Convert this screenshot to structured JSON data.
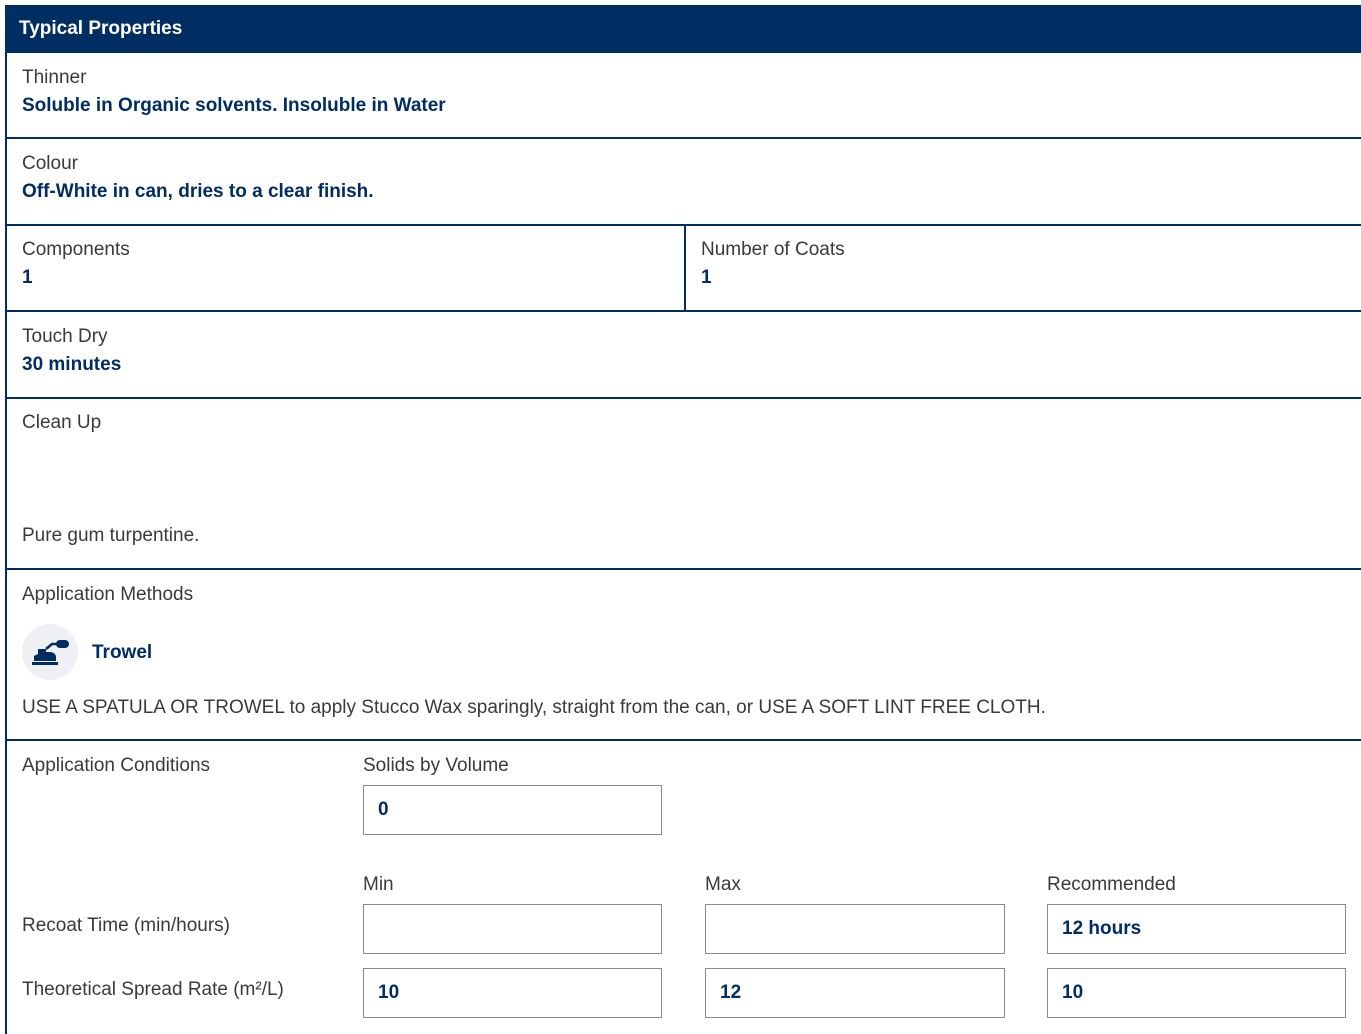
{
  "header": {
    "title": "Typical Properties"
  },
  "thinner": {
    "label": "Thinner",
    "value": "Soluble in Organic solvents. Insoluble in Water"
  },
  "colour": {
    "label": "Colour",
    "value": "Off-White in can, dries to a clear finish."
  },
  "components": {
    "label": "Components",
    "value": "1"
  },
  "coats": {
    "label": "Number of Coats",
    "value": "1"
  },
  "touch_dry": {
    "label": "Touch Dry",
    "value": "30 minutes"
  },
  "clean_up": {
    "label": "Clean Up",
    "value": "Pure gum turpentine."
  },
  "application_methods": {
    "label": "Application Methods",
    "method": {
      "name": "Trowel",
      "icon": "trowel-icon"
    },
    "description": "USE A SPATULA OR TROWEL to apply Stucco Wax sparingly, straight from the can, or USE A SOFT LINT FREE CLOTH."
  },
  "application_conditions": {
    "label": "Application Conditions",
    "solids_by_volume": {
      "label": "Solids by Volume",
      "value": "0"
    },
    "columns": {
      "min": "Min",
      "max": "Max",
      "recommended": "Recommended"
    },
    "recoat_time": {
      "label": "Recoat Time (min/hours)",
      "min": "",
      "max": "",
      "recommended": "12 hours"
    },
    "spread_rate": {
      "label": "Theoretical Spread Rate (m²/L)",
      "min": "10",
      "max": "12",
      "recommended": "10"
    }
  },
  "colors": {
    "brand": "#002d62",
    "field_border": "#8a8a8a",
    "icon_bg": "#eef0f3"
  }
}
